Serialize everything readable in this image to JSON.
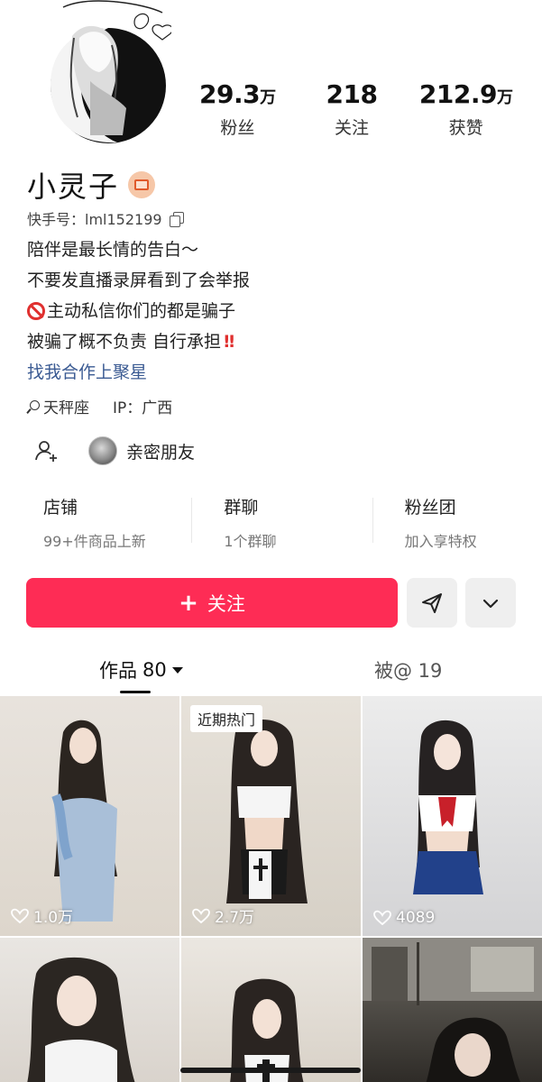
{
  "profile": {
    "name": "小灵子",
    "uid_label": "快手号：lml152199",
    "stats": [
      {
        "value": "29.3",
        "unit": "万",
        "label": "粉丝"
      },
      {
        "value": "218",
        "unit": "",
        "label": "关注"
      },
      {
        "value": "212.9",
        "unit": "万",
        "label": "获赞"
      }
    ],
    "bio": [
      "陪伴是最长情的告白～",
      "不要发直播录屏看到了会举报",
      "主动私信你们的都是骗子",
      "被骗了概不负责 自行承担"
    ],
    "bio_link": "找我合作上聚星",
    "zodiac": "天秤座",
    "ip": "IP：广西",
    "close_friends_label": "亲密朋友"
  },
  "shortcuts": [
    {
      "title": "店铺",
      "sub": "99+件商品上新"
    },
    {
      "title": "群聊",
      "sub": "1个群聊"
    },
    {
      "title": "粉丝团",
      "sub": "加入享特权"
    }
  ],
  "actions": {
    "follow_label": "关注"
  },
  "tabs": {
    "works_label": "作品",
    "works_count": "80",
    "mentions_label": "被@ 19"
  },
  "grid": [
    {
      "likes": "1.0万"
    },
    {
      "likes": "2.7万",
      "tag": "近期热门"
    },
    {
      "likes": "4089"
    },
    {
      "likes": ""
    },
    {
      "likes": ""
    },
    {
      "likes": ""
    }
  ],
  "colors": {
    "accent": "#fe2c55",
    "link": "#3b5b93"
  }
}
